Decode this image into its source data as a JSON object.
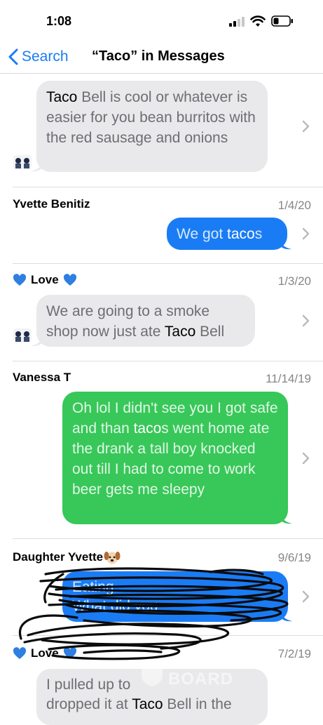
{
  "status": {
    "time": "1:08"
  },
  "nav": {
    "back_label": "Search",
    "title": "“Taco” in Messages"
  },
  "results": [
    {
      "sender": "",
      "date": "",
      "segments": [
        {
          "text": "Taco",
          "hl": true
        },
        {
          "text": " Bell is cool or whatever is easier for you bean burritos with the red sausage and onions",
          "hl": false
        }
      ]
    },
    {
      "sender": "Yvette Benitiz",
      "date": "1/4/20",
      "segments": [
        {
          "text": "We got ",
          "hl": false
        },
        {
          "text": "taco",
          "hl": true
        },
        {
          "text": "s",
          "hl": false
        }
      ]
    },
    {
      "sender": "Love",
      "date": "1/3/20",
      "segments": [
        {
          "text": "We are going to a smoke shop now just ate ",
          "hl": false
        },
        {
          "text": "Taco",
          "hl": true
        },
        {
          "text": " Bell",
          "hl": false
        }
      ]
    },
    {
      "sender": "Vanessa T",
      "date": "11/14/19",
      "segments": [
        {
          "text": "Oh lol I didn't see you I got safe and than ",
          "hl": false
        },
        {
          "text": "taco",
          "hl": true
        },
        {
          "text": "s went home ate the drank a tall boy knocked out till I had to come to work beer gets me sleepy",
          "hl": false
        }
      ]
    },
    {
      "sender": "Daughter Yvette",
      "date": "9/6/19",
      "segments": [
        {
          "text": "Eating ",
          "hl": false
        },
        {
          "text": "What did you",
          "hl": false
        }
      ]
    },
    {
      "sender": "Love",
      "date": "7/2/19",
      "segments": [
        {
          "text": "I pulled up to",
          "hl": false
        },
        {
          "text": "dropped it at ",
          "hl": false
        },
        {
          "text": "Taco",
          "hl": true
        },
        {
          "text": " Bell in the",
          "hl": false
        }
      ]
    }
  ],
  "icons": {
    "back": "chevron-left-icon",
    "disclosure": "chevron-right-icon",
    "heart": "blue-heart-icon",
    "dog": "dog-face-icon"
  },
  "colors": {
    "accent": "#1a7cf5",
    "imessage_blue": "#1a7cf5",
    "sms_green": "#38c759",
    "incoming_gray": "#e9e9eb",
    "date_gray": "#85858a"
  },
  "watermark": "BOARD"
}
